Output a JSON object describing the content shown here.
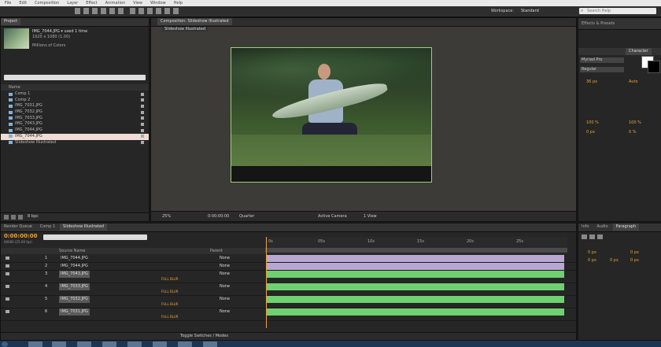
{
  "menu": {
    "items": [
      "File",
      "Edit",
      "Composition",
      "Layer",
      "Effect",
      "Animation",
      "View",
      "Window",
      "Help"
    ]
  },
  "toolbar": {
    "workspace_label": "Workspace:",
    "workspace_value": "Standard",
    "search_placeholder": "Search Help"
  },
  "project": {
    "tab_label": "Project",
    "selected_name": "IMG_7044.JPG ▾ used 1 time",
    "selected_dims": "1920 x 1080 (1.00)",
    "selected_info": "Millions of Colors",
    "search_value": "",
    "col_name": "Name",
    "items": [
      {
        "label": "Comp 1",
        "sel": false
      },
      {
        "label": "Comp 2",
        "sel": false
      },
      {
        "label": "IMG_7031.JPG",
        "sel": false
      },
      {
        "label": "IMG_7032.JPG",
        "sel": false
      },
      {
        "label": "IMG_7033.JPG",
        "sel": false
      },
      {
        "label": "IMG_7043.JPG",
        "sel": false
      },
      {
        "label": "IMG_7044.JPG",
        "sel": false
      },
      {
        "label": "IMG_7044.JPG",
        "sel": true
      },
      {
        "label": "Slideshow Illustrated",
        "sel": false
      }
    ],
    "bpc": "8 bpc"
  },
  "composition": {
    "tab_label": "Composition: Slideshow Illustrated",
    "sub_label": "Slideshow Illustrated",
    "zoom": "25%",
    "timecode": "0:00:00:00",
    "resolution": "Quarter",
    "camera": "Active Camera",
    "views": "1 View"
  },
  "right_top": {
    "tab1": "Effects & Presets",
    "tab2": "Character",
    "font_value": "Myriad Pro",
    "style_value": "Regular",
    "size_value": "36 px",
    "tracking": "Auto",
    "scale_v": "100 %",
    "scale_h": "100 %",
    "baseline": "0 px",
    "tsume": "0 %"
  },
  "right_bottom": {
    "tab1": "Info",
    "tab2": "Audio",
    "tab3": "Paragraph",
    "indent_1": "0 px",
    "indent_2": "0 px",
    "indent_3": "0 px",
    "space_1": "0 px",
    "space_2": "0 px"
  },
  "timeline": {
    "tab1": "Render Queue",
    "tab2": "Comp 1",
    "tab3": "Slideshow Illustrated",
    "timecode": "0:00:00:00",
    "fps": "00000 (25.00 fps)",
    "col_source": "Source Name",
    "col_parent": "Parent",
    "ruler": [
      "0s",
      "05s",
      "10s",
      "15s",
      "20s",
      "25s"
    ],
    "toggle_label": "Toggle Switches / Modes",
    "layers": [
      {
        "num": "1",
        "name": "IMG_7044.JPG",
        "mode": "None",
        "color": "#b9a7d3",
        "fx": false
      },
      {
        "num": "2",
        "name": "IMG_7044.JPG",
        "mode": "None",
        "color": "#b9a7d3",
        "fx": false
      },
      {
        "num": "3",
        "name": "IMG_7043.JPG",
        "mode": "None",
        "color": "#6fd06f",
        "fx": true
      },
      {
        "num": "4",
        "name": "IMG_7033.JPG",
        "mode": "None",
        "color": "#6fd06f",
        "fx": true
      },
      {
        "num": "5",
        "name": "IMG_7032.JPG",
        "mode": "None",
        "color": "#6fd06f",
        "fx": true
      },
      {
        "num": "6",
        "name": "IMG_7031.JPG",
        "mode": "None",
        "color": "#6fd06f",
        "fx": true
      }
    ],
    "fx_label": "FULL BLUR"
  }
}
